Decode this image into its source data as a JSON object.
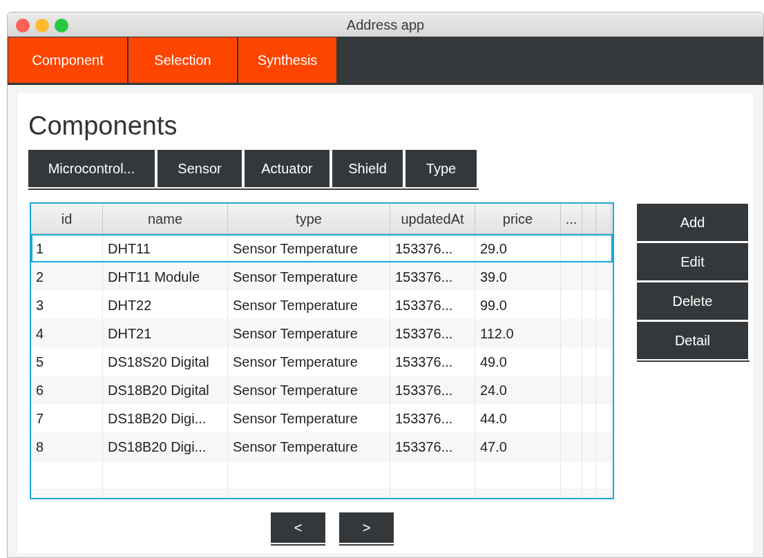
{
  "window": {
    "title": "Address app"
  },
  "nav_tabs": [
    {
      "label": "Component"
    },
    {
      "label": "Selection"
    },
    {
      "label": "Synthesis"
    }
  ],
  "heading": "Components",
  "category_tabs": [
    {
      "label": "Microcontrol..."
    },
    {
      "label": "Sensor"
    },
    {
      "label": "Actuator"
    },
    {
      "label": "Shield"
    },
    {
      "label": "Type"
    }
  ],
  "table": {
    "columns": [
      "id",
      "name",
      "type",
      "updatedAt",
      "price",
      "...",
      "",
      ""
    ],
    "rows": [
      {
        "cells": [
          "1",
          "DHT11",
          "Sensor Temperature",
          "153376...",
          "29.0"
        ],
        "selected": true
      },
      {
        "cells": [
          "2",
          "DHT11 Module",
          "Sensor Temperature",
          "153376...",
          "39.0"
        ],
        "selected": false
      },
      {
        "cells": [
          "3",
          "DHT22",
          "Sensor Temperature",
          "153376...",
          "99.0"
        ],
        "selected": false
      },
      {
        "cells": [
          "4",
          "DHT21",
          "Sensor Temperature",
          "153376...",
          "112.0"
        ],
        "selected": false
      },
      {
        "cells": [
          "5",
          "DS18S20 Digital",
          "Sensor Temperature",
          "153376...",
          "49.0"
        ],
        "selected": false
      },
      {
        "cells": [
          "6",
          "DS18B20 Digital",
          "Sensor Temperature",
          "153376...",
          "24.0"
        ],
        "selected": false
      },
      {
        "cells": [
          "7",
          "DS18B20 Digi...",
          "Sensor Temperature",
          "153376...",
          "44.0"
        ],
        "selected": false
      },
      {
        "cells": [
          "8",
          "DS18B20 Digi...",
          "Sensor Temperature",
          "153376...",
          "47.0"
        ],
        "selected": false
      }
    ]
  },
  "actions": [
    "Add",
    "Edit",
    "Delete",
    "Detail"
  ],
  "pager": [
    "<",
    ">"
  ]
}
